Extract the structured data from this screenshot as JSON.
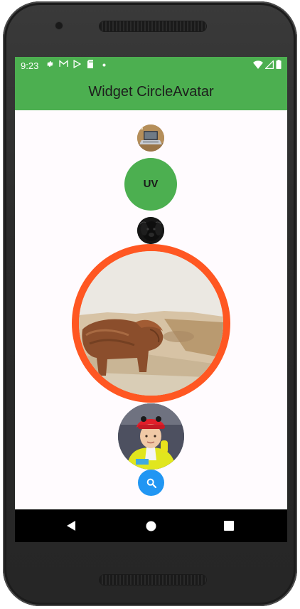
{
  "status_bar": {
    "time": "9:23",
    "left_icons": [
      "settings-icon",
      "gmail-icon",
      "play-store-icon",
      "sd-card-icon",
      "dot-icon"
    ],
    "right_icons": [
      "wifi-icon",
      "signal-icon",
      "battery-icon"
    ]
  },
  "app_bar": {
    "title": "Widget CircleAvatar",
    "color": "#4caf50"
  },
  "avatars": {
    "laptop_image": "laptop-photo",
    "text_avatar": {
      "label": "UV",
      "background": "#4caf50"
    },
    "dog_image": "black-dog-photo",
    "large_image": {
      "image": "highland-cow-photo",
      "border_color": "#ff5722"
    },
    "child_image": "child-with-red-cap-photo"
  },
  "search_button": {
    "icon": "search-icon",
    "color": "#2196f3"
  },
  "nav_bar": {
    "buttons": [
      "back-icon",
      "home-icon",
      "recents-icon"
    ]
  }
}
